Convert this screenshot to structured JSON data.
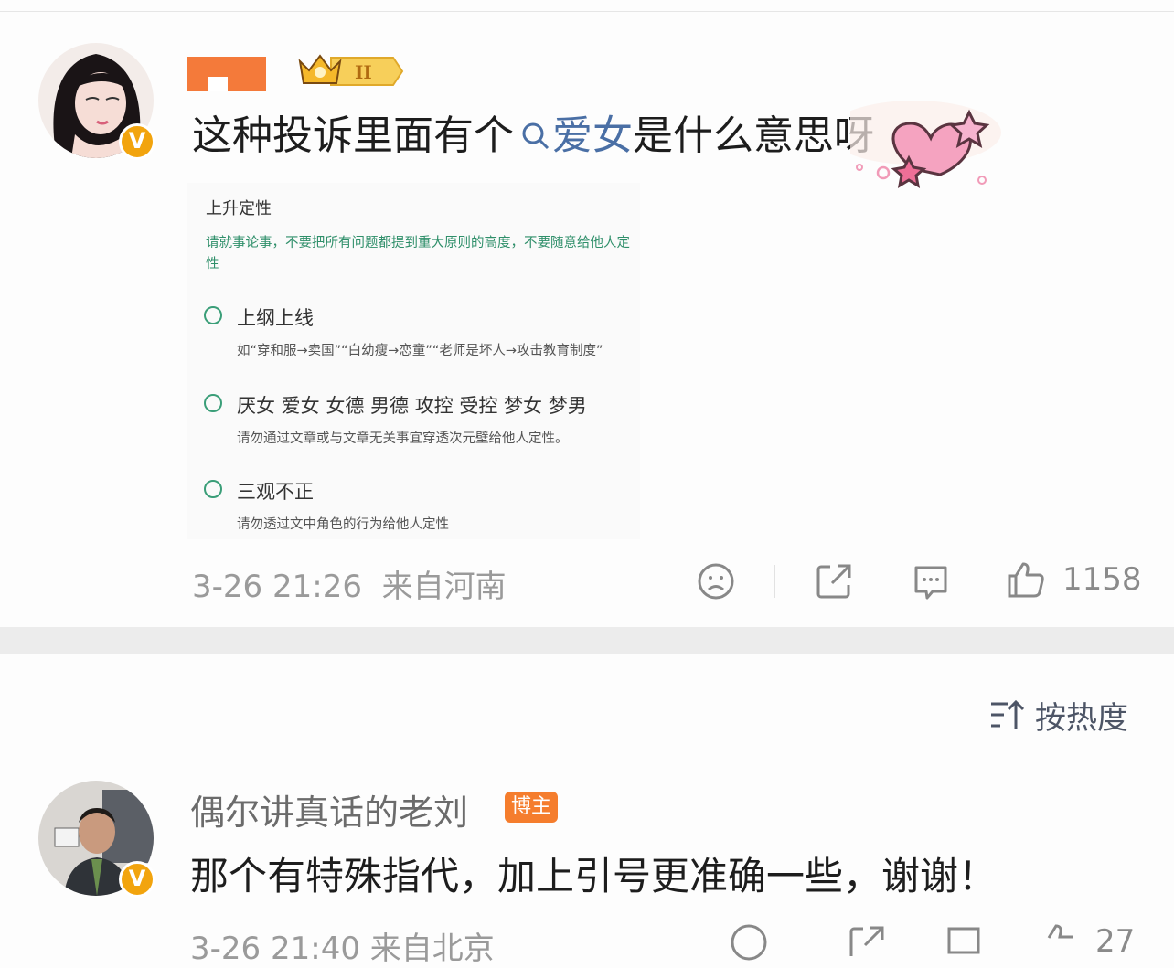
{
  "post": {
    "badge_level": "II",
    "text_before": "这种投诉里面有个",
    "topic": "爱女",
    "text_after": "是什么意思呀",
    "embedded": {
      "section_title": "上升定性",
      "hint": "请就事论事，不要把所有问题都提到重大原则的高度，不要随意给他人定性",
      "options": [
        {
          "label": "上纲上线",
          "desc": "如“穿和服→卖国”“白幼瘦→恋童”“老师是坏人→攻击教育制度”"
        },
        {
          "label": "厌女 爱女 女德 男德 攻控 受控 梦女 梦男",
          "desc": "请勿通过文章或与文章无关事宜穿透次元壁给他人定性。"
        },
        {
          "label": "三观不正",
          "desc": "请勿透过文中角色的行为给他人定性"
        }
      ]
    },
    "time": "3-26 21:26",
    "source": "来自河南",
    "like_count": "1158"
  },
  "comments_header": {
    "sort_label": "按热度"
  },
  "comment": {
    "author": "偶尔讲真话的老刘",
    "role_badge": "博主",
    "text": "那个有特殊指代，加上引号更准确一些，谢谢！",
    "meta_partial": "3-26 21:40  来自北京",
    "like_count": "27"
  },
  "colors": {
    "accent_orange": "#f57d2d",
    "verified_gold": "#f2a40e",
    "topic_blue": "#4a6fa5",
    "option_green": "#3a9e78"
  },
  "icons": [
    "search-icon",
    "dislike-face-icon",
    "share-icon",
    "comment-icon",
    "thumbs-up-icon",
    "sort-icon",
    "verified-v-icon"
  ]
}
